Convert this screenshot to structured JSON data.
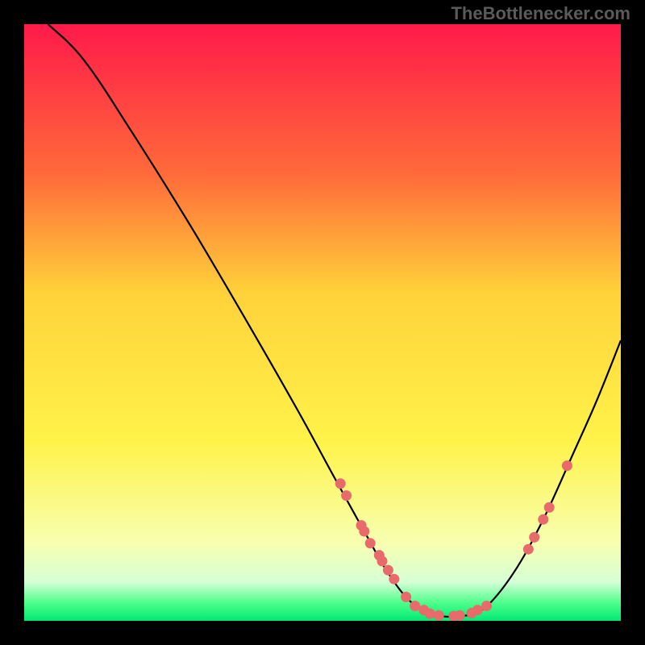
{
  "attribution": "TheBottlenecker.com",
  "chart_data": {
    "type": "line",
    "title": "",
    "xlabel": "",
    "ylabel": "",
    "xlim": [
      0,
      100
    ],
    "ylim": [
      0,
      100
    ],
    "gradient_stops": [
      {
        "offset": 0.0,
        "color": "#ff1a4a"
      },
      {
        "offset": 0.25,
        "color": "#ff6a3a"
      },
      {
        "offset": 0.45,
        "color": "#ffd23a"
      },
      {
        "offset": 0.7,
        "color": "#fff34a"
      },
      {
        "offset": 0.87,
        "color": "#f7ffb0"
      },
      {
        "offset": 0.935,
        "color": "#d6ffd6"
      },
      {
        "offset": 0.97,
        "color": "#4dff8a"
      },
      {
        "offset": 1.0,
        "color": "#00e874"
      }
    ],
    "curve": [
      {
        "x": 4,
        "y": 100
      },
      {
        "x": 10,
        "y": 94
      },
      {
        "x": 18,
        "y": 82
      },
      {
        "x": 28,
        "y": 66
      },
      {
        "x": 38,
        "y": 49
      },
      {
        "x": 46,
        "y": 35
      },
      {
        "x": 52,
        "y": 24
      },
      {
        "x": 57,
        "y": 15
      },
      {
        "x": 61,
        "y": 8
      },
      {
        "x": 65,
        "y": 3
      },
      {
        "x": 69,
        "y": 1
      },
      {
        "x": 73,
        "y": 0.8
      },
      {
        "x": 77,
        "y": 2
      },
      {
        "x": 82,
        "y": 8
      },
      {
        "x": 87,
        "y": 17
      },
      {
        "x": 92,
        "y": 28
      },
      {
        "x": 96,
        "y": 37
      },
      {
        "x": 100,
        "y": 47
      }
    ],
    "markers": [
      {
        "x": 53,
        "y": 23
      },
      {
        "x": 54,
        "y": 21
      },
      {
        "x": 56.5,
        "y": 16
      },
      {
        "x": 57,
        "y": 15
      },
      {
        "x": 58,
        "y": 13
      },
      {
        "x": 59.5,
        "y": 11
      },
      {
        "x": 60,
        "y": 10
      },
      {
        "x": 61,
        "y": 8.5
      },
      {
        "x": 62,
        "y": 7
      },
      {
        "x": 64,
        "y": 4
      },
      {
        "x": 65.5,
        "y": 2.5
      },
      {
        "x": 67,
        "y": 1.8
      },
      {
        "x": 68,
        "y": 1.2
      },
      {
        "x": 69.5,
        "y": 0.9
      },
      {
        "x": 72,
        "y": 0.8
      },
      {
        "x": 73,
        "y": 0.9
      },
      {
        "x": 75,
        "y": 1.3
      },
      {
        "x": 76,
        "y": 1.8
      },
      {
        "x": 77.5,
        "y": 2.5
      },
      {
        "x": 84.5,
        "y": 12
      },
      {
        "x": 85.5,
        "y": 14
      },
      {
        "x": 87,
        "y": 17
      },
      {
        "x": 88,
        "y": 19
      },
      {
        "x": 91,
        "y": 26
      }
    ],
    "marker_color": "#e86a6a",
    "line_color": "#000000"
  }
}
